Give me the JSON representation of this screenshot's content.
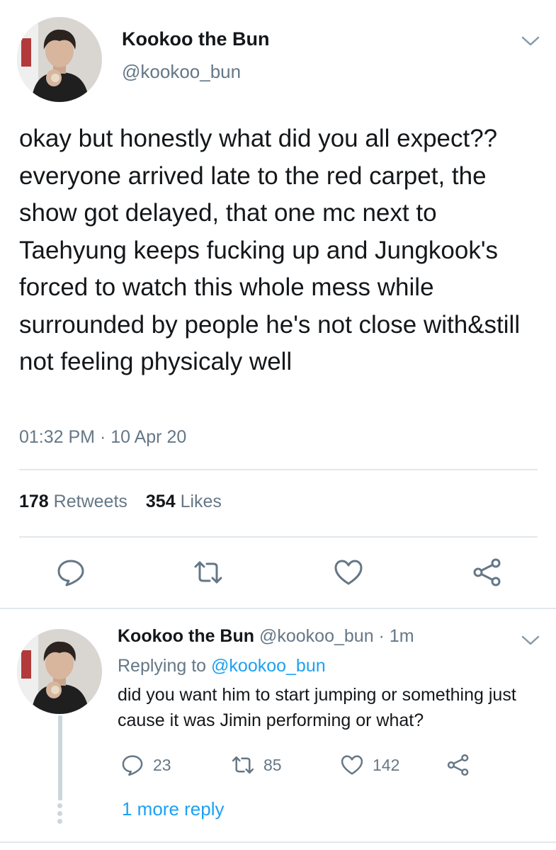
{
  "main_tweet": {
    "author": {
      "display_name": "Kookoo the Bun",
      "handle": "@kookoo_bun",
      "avatar_icon": "profile-photo-avatar"
    },
    "text": "okay but honestly what did you all expect?? everyone arrived late to the red carpet, the show got delayed, that one mc next to Taehyung keeps fucking up and Jungkook's forced to watch this whole mess while surrounded by people he's not close with&still not feeling physicaly well",
    "timestamp": "01:32 PM · 10 Apr 20",
    "stats": {
      "retweets_count": "178",
      "retweets_label": "Retweets",
      "likes_count": "354",
      "likes_label": "Likes"
    },
    "actions": [
      "reply-icon",
      "retweet-icon",
      "like-icon",
      "share-icon"
    ]
  },
  "reply_tweet": {
    "author": {
      "display_name": "Kookoo the Bun",
      "handle": "@kookoo_bun",
      "time": "· 1m"
    },
    "replying_to_label": "Replying to",
    "replying_to_handle": "@kookoo_bun",
    "text": "did you want him to start jumping or something just cause it was Jimin performing or what?",
    "counts": {
      "replies": "23",
      "retweets": "85",
      "likes": "142"
    },
    "more_replies": "1 more reply"
  },
  "colors": {
    "text_primary": "#14171a",
    "text_secondary": "#657786",
    "link": "#1da1f2",
    "divider": "#e1e8ed"
  }
}
